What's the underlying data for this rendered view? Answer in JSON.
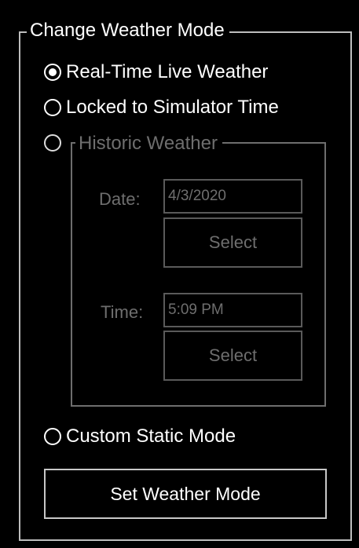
{
  "group": {
    "title": "Change Weather Mode"
  },
  "modes": [
    {
      "label": "Real-Time Live Weather",
      "checked": true,
      "enabled": true
    },
    {
      "label": "Locked to Simulator Time",
      "checked": false,
      "enabled": true
    },
    {
      "label": "",
      "checked": false,
      "enabled": true
    },
    {
      "label": "Custom Static Mode",
      "checked": false,
      "enabled": true
    }
  ],
  "historic": {
    "title": "Historic Weather",
    "enabled": false,
    "date_label": "Date:",
    "date_value": "4/3/2020",
    "date_select_label": "Select",
    "time_label": "Time:",
    "time_value": "5:09 PM",
    "time_select_label": "Select"
  },
  "set_button_label": "Set Weather Mode",
  "colors": {
    "background": "#000000",
    "text": "#ffffff",
    "frame": "#bdbdbd",
    "disabled_text": "#6e6e6e",
    "disabled_border": "#5a5a5a"
  }
}
